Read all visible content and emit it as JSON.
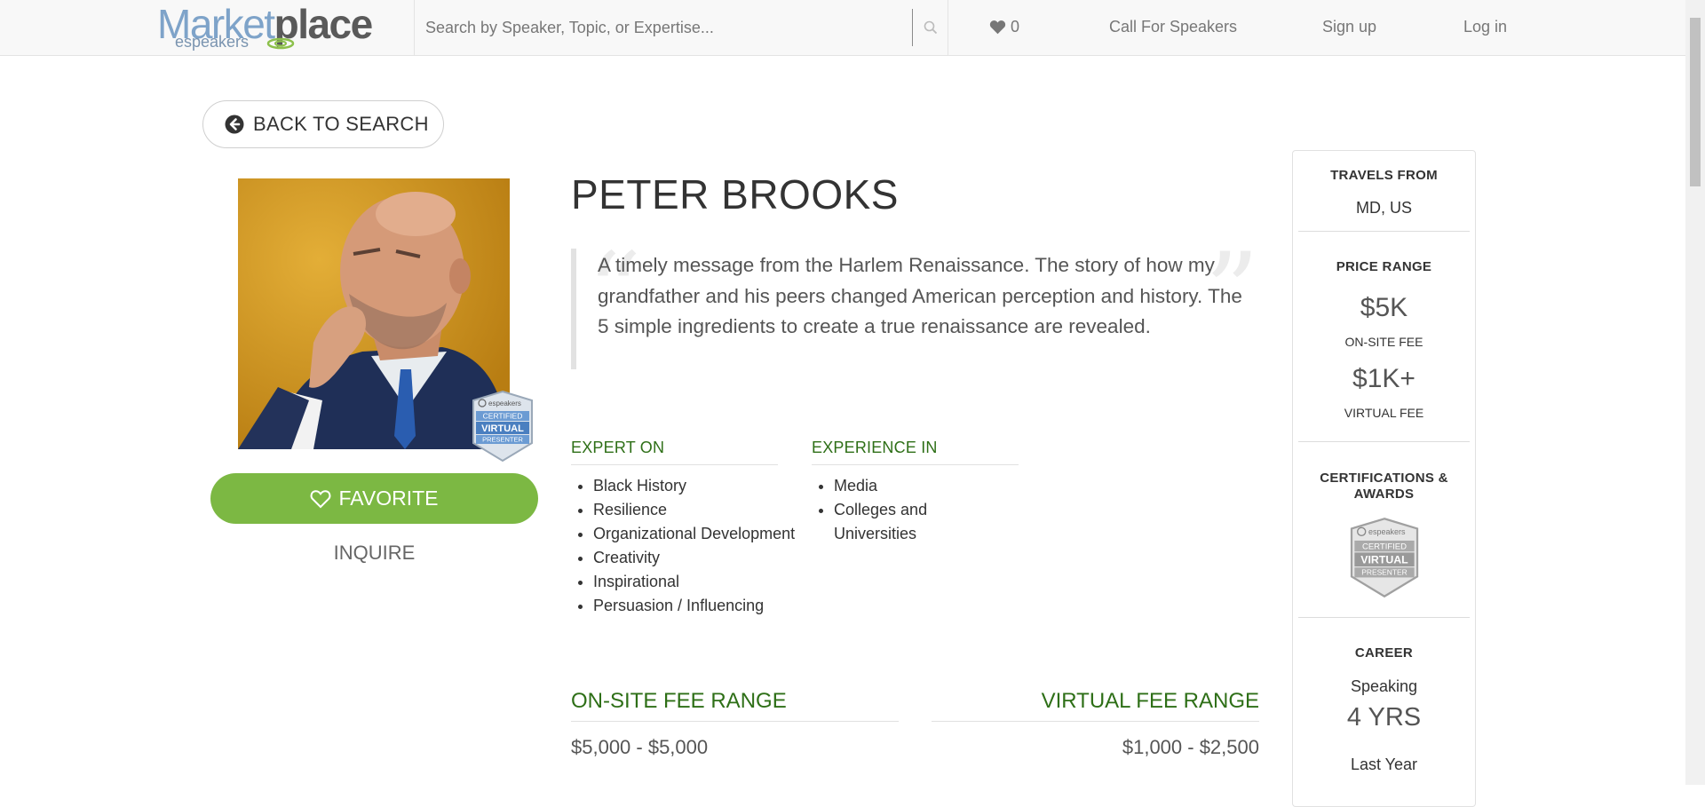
{
  "nav": {
    "logo_word_a": "Market",
    "logo_word_b": "place",
    "logo_sub": "espeakers",
    "search_placeholder": "Search by Speaker, Topic, or Expertise...",
    "favorites_count": "0",
    "call_for_speakers": "Call For Speakers",
    "sign_up": "Sign up",
    "log_in": "Log in"
  },
  "back_label": "BACK TO SEARCH",
  "speaker": {
    "name": "PETER BROOKS",
    "quote": "A timely message from the Harlem Renaissance. The story of how my grandfather and his peers changed American perception and history. The 5 simple ingredients to create a true renaissance are revealed.",
    "favorite_label": "FAVORITE",
    "inquire_label": "INQUIRE"
  },
  "badge": {
    "brand": "espeakers",
    "line1": "CERTIFIED",
    "line2": "VIRTUAL",
    "line3": "PRESENTER"
  },
  "expert_on": {
    "heading": "EXPERT ON",
    "items": [
      "Black History",
      "Resilience",
      "Organizational Development",
      "Creativity",
      "Inspirational",
      "Persuasion / Influencing"
    ]
  },
  "experience_in": {
    "heading": "EXPERIENCE IN",
    "items": [
      "Media",
      "Colleges and Universities"
    ]
  },
  "fees": {
    "onsite_heading": "ON-SITE FEE RANGE",
    "onsite_value": "$5,000 - $5,000",
    "virtual_heading": "VIRTUAL FEE RANGE",
    "virtual_value": "$1,000 - $2,500"
  },
  "sidebar": {
    "travels_from_label": "TRAVELS FROM",
    "travels_from_value": "MD, US",
    "price_range_label": "PRICE RANGE",
    "onsite_price": "$5K",
    "onsite_caption": "ON-SITE FEE",
    "virtual_price": "$1K+",
    "virtual_caption": "VIRTUAL FEE",
    "certifications_label": "CERTIFICATIONS & AWARDS",
    "career_label": "CAREER",
    "career_sub": "Speaking",
    "career_years": "4 YRS",
    "last_year_label": "Last Year"
  },
  "colors": {
    "accent_green": "#7cb843",
    "heading_green": "#2e6f17",
    "logo_blue": "#7ea3c9"
  },
  "icons": [
    "search-icon",
    "heart-icon",
    "arrow-circle-left-icon",
    "heart-outline-icon"
  ]
}
